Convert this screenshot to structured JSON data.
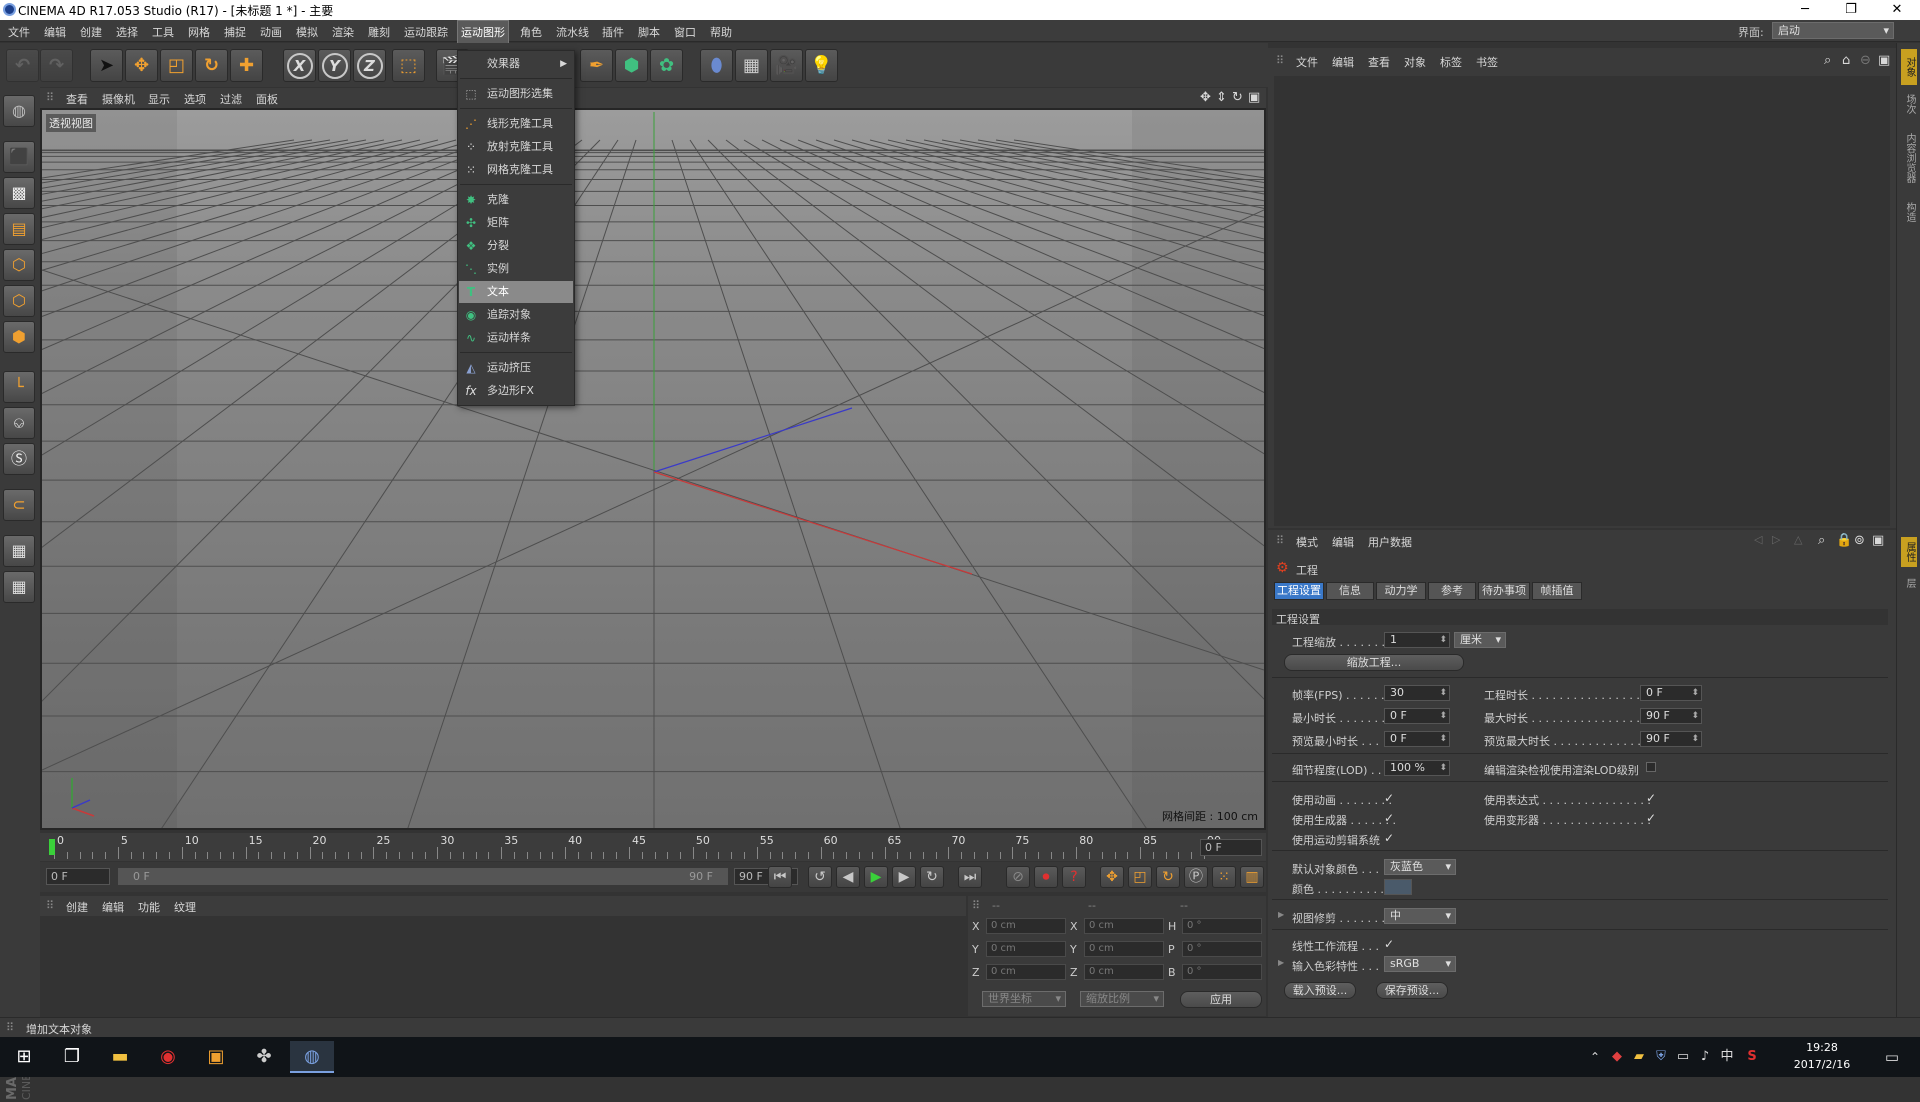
{
  "window": {
    "title": "CINEMA 4D R17.053 Studio (R17) - [未标题 1 *] - 主要",
    "minimize": "─",
    "maximize": "❐",
    "close": "✕"
  },
  "menubar": {
    "items": [
      "文件",
      "编辑",
      "创建",
      "选择",
      "工具",
      "网格",
      "捕捉",
      "动画",
      "模拟",
      "渲染",
      "雕刻",
      "运动跟踪",
      "运动图形",
      "角色",
      "流水线",
      "插件",
      "脚本",
      "窗口",
      "帮助"
    ],
    "active": "运动图形",
    "layout_label": "界面:",
    "layout_value": "启动"
  },
  "mograph_menu": {
    "items": [
      {
        "label": "效果器",
        "icon": "",
        "submenu": true
      },
      {
        "label": "运动图形选集",
        "icon": "selection-icon"
      },
      {
        "label": "线形克隆工具",
        "icon": "linear-clone-icon"
      },
      {
        "label": "放射克隆工具",
        "icon": "radial-clone-icon"
      },
      {
        "label": "网格克隆工具",
        "icon": "grid-clone-icon"
      },
      {
        "label": "克隆",
        "icon": "cloner-icon"
      },
      {
        "label": "矩阵",
        "icon": "matrix-icon"
      },
      {
        "label": "分裂",
        "icon": "fracture-icon"
      },
      {
        "label": "实例",
        "icon": "instance-icon"
      },
      {
        "label": "文本",
        "icon": "text-icon",
        "highlight": true
      },
      {
        "label": "追踪对象",
        "icon": "tracer-icon"
      },
      {
        "label": "运动样条",
        "icon": "mospline-icon"
      },
      {
        "label": "运动挤压",
        "icon": "extrude-icon"
      },
      {
        "label": "多边形FX",
        "icon": "polyfx-icon"
      }
    ]
  },
  "viewport": {
    "menu": [
      "查看",
      "摄像机",
      "显示",
      "选项",
      "过滤",
      "面板"
    ],
    "label": "透视视图",
    "grid_spacing": "网格间距 : 100 cm"
  },
  "timeline": {
    "ticks": [
      "0",
      "5",
      "10",
      "15",
      "20",
      "25",
      "30",
      "35",
      "40",
      "45",
      "50",
      "55",
      "60",
      "65",
      "70",
      "75",
      "80",
      "85",
      "90"
    ],
    "current": "0 F"
  },
  "playbar": {
    "start": "0 F",
    "range_start": "0 F",
    "range_end": "90 F",
    "end": "90 F"
  },
  "material_menu": [
    "创建",
    "编辑",
    "功能",
    "纹理"
  ],
  "coords": {
    "headers": [
      "--",
      "--",
      "--"
    ],
    "rows": [
      {
        "a": "X",
        "av": "0 cm",
        "b": "X",
        "bv": "0 cm",
        "c": "H",
        "cv": "0 °"
      },
      {
        "a": "Y",
        "av": "0 cm",
        "b": "Y",
        "bv": "0 cm",
        "c": "P",
        "cv": "0 °"
      },
      {
        "a": "Z",
        "av": "0 cm",
        "b": "Z",
        "bv": "0 cm",
        "c": "B",
        "cv": "0 °"
      }
    ],
    "world": "世界坐标",
    "scale": "缩放比例",
    "apply": "应用"
  },
  "status": "增加文本对象",
  "object_panel": {
    "menu": [
      "文件",
      "编辑",
      "查看",
      "对象",
      "标签",
      "书签"
    ]
  },
  "attr_panel": {
    "menu": [
      "模式",
      "编辑",
      "用户数据"
    ],
    "title": "工程",
    "tabs": [
      "工程设置",
      "信息",
      "动力学",
      "参考",
      "待办事项",
      "帧插值"
    ],
    "section": "工程设置",
    "scale_label": "工程缩放 . . . . . . .",
    "scale_value": "1",
    "scale_unit": "厘米",
    "scale_btn": "缩放工程...",
    "fps_label": "帧率(FPS) . . . . . .",
    "fps": "30",
    "dur_label": "工程时长 . . . . . . . . . . . . . . . . .",
    "dur": "0 F",
    "min_label": "最小时长 . . . . . . .",
    "min": "0 F",
    "max_label": "最大时长 . . . . . . . . . . . . . . . . .",
    "max": "90 F",
    "pmin_label": "预览最小时长 . . .",
    "pmin": "0 F",
    "pmax_label": "预览最大时长 . . . . . . . . . . . . .",
    "pmax": "90 F",
    "lod_label": "细节程度(LOD) . . .",
    "lod": "100 %",
    "lod2_label": "编辑渲染检视使用渲染LOD级别",
    "anim_label": "使用动画 . . . . . . . .",
    "expr_label": "使用表达式 . . . . . . . . . . . . . . . .",
    "gen_label": "使用生成器 . . . . . . .",
    "def_label": "使用变形器 . . . . . . . . . . . . . . . .",
    "mo_label": "使用运动剪辑系统",
    "color_label": "默认对象颜色 . . .",
    "color_value": "灰蓝色",
    "col_label": "颜色 . . . . . . . . . .",
    "clip_label": "视图修剪 . . . . . . .",
    "clip_value": "中",
    "lin_label": "线性工作流程 . . .",
    "cs_label": "输入色彩特性 . . .",
    "cs_value": "sRGB",
    "load_btn": "载入预设...",
    "save_btn": "保存预设...",
    "check": "✓",
    "swatch_color": "#4a5a6a"
  },
  "right_tabs": [
    "对象",
    "场次",
    "内容浏览器",
    "构造",
    "属性",
    "层"
  ],
  "taskbar": {
    "time": "19:28",
    "date": "2017/2/16",
    "ime": "中"
  },
  "colors": {
    "accent": "#3a78c8",
    "highlight": "#8a8a8a"
  }
}
